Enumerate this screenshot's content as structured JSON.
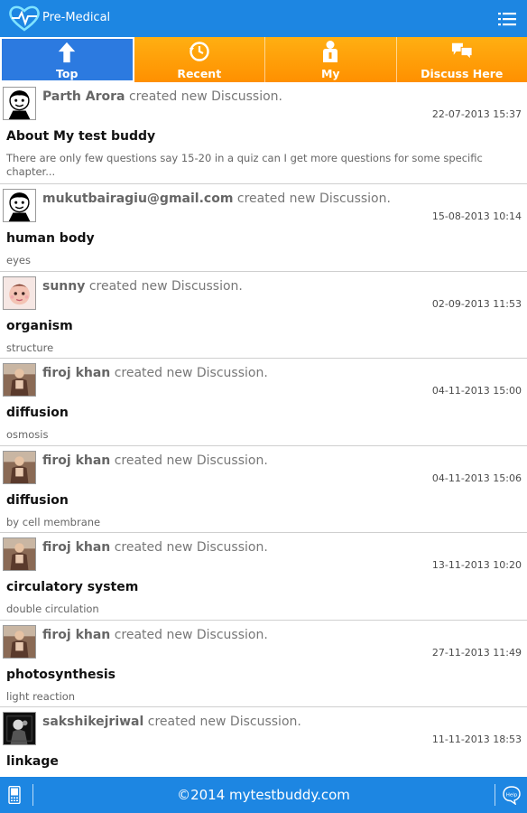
{
  "app": {
    "title": "Pre-Medical"
  },
  "tabs": [
    {
      "label": "Top",
      "icon": "arrow-up-icon"
    },
    {
      "label": "Recent",
      "icon": "clock-icon"
    },
    {
      "label": "My",
      "icon": "person-icon"
    },
    {
      "label": "Discuss Here",
      "icon": "chat-bubbles-icon"
    }
  ],
  "activeTab": "Top",
  "activity_suffix": "created new Discussion.",
  "discussions": [
    {
      "user": "Parth Arora",
      "date": "22-07-2013 15:37",
      "title": "About My test buddy",
      "description": "There are only few questions say 15-20 in a quiz can I get more questions for some specific chapter..."
    },
    {
      "user": "mukutbairagiu@gmail.com",
      "date": "15-08-2013 10:14",
      "title": "human body",
      "description": "eyes"
    },
    {
      "user": "sunny",
      "date": "02-09-2013 11:53",
      "title": "organism",
      "description": "structure"
    },
    {
      "user": "firoj khan",
      "date": "04-11-2013 15:00",
      "title": "diffusion",
      "description": "osmosis"
    },
    {
      "user": "firoj khan",
      "date": "04-11-2013 15:06",
      "title": "diffusion",
      "description": "by cell membrane"
    },
    {
      "user": "firoj khan",
      "date": "13-11-2013 10:20",
      "title": "circulatory system",
      "description": "double circulation"
    },
    {
      "user": "firoj khan",
      "date": "27-11-2013 11:49",
      "title": "photosynthesis",
      "description": "light reaction"
    },
    {
      "user": "sakshikejriwal",
      "date": "11-11-2013 18:53",
      "title": "linkage",
      "description": ""
    }
  ],
  "footer": {
    "copyright": "©2014 mytestbuddy.com",
    "help_label": "Help"
  },
  "colors": {
    "bar_blue": "#1d86e2",
    "tab_orange": "#ff9f0d"
  }
}
